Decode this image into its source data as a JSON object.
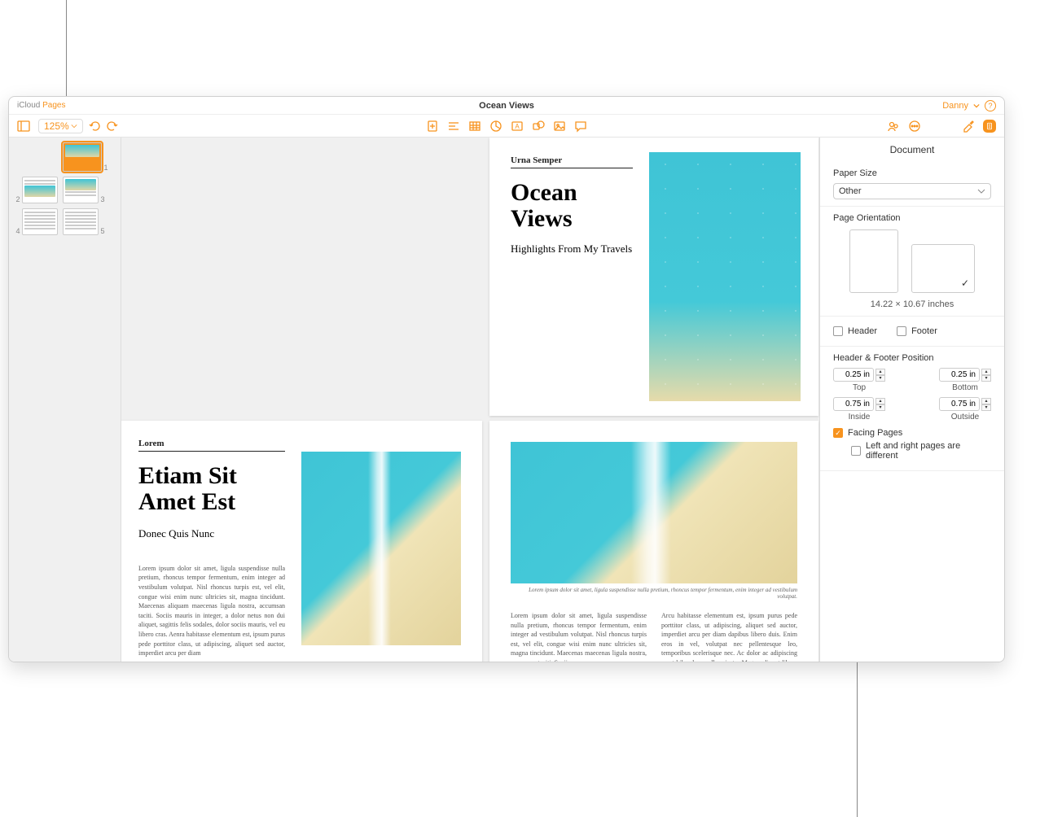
{
  "app": {
    "brand_prefix": "iCloud",
    "brand_name": "Pages"
  },
  "titlebar": {
    "doc_title": "Ocean Views",
    "user": "Danny"
  },
  "toolbar": {
    "zoom": "125%"
  },
  "thumbnails": {
    "pages": [
      1,
      2,
      3,
      4,
      5
    ],
    "selected": 1
  },
  "canvas": {
    "page1": {
      "header": "Urna Semper",
      "title": "Ocean Views",
      "subtitle": "Highlights From My Travels"
    },
    "page2": {
      "header": "Lorem",
      "title": "Etiam Sit Amet Est",
      "subtitle": "Donec Quis Nunc",
      "body": "Lorem ipsum dolor sit amet, ligula suspendisse nulla pretium, rhoncus tempor fermentum, enim integer ad vestibulum volutpat. Nisl rhoncus turpis est, vel elit, congue wisi enim nunc ultricies sit, magna tincidunt. Maecenas aliquam maecenas ligula nostra, accumsan taciti. Sociis mauris in integer, a dolor netus non dui aliquet, sagittis felis sodales, dolor sociis mauris, vel eu libero cras. Aenra habitasse elementum est, ipsum purus pede porttitor class, ut adipiscing, aliquet sed auctor, imperdiet arcu per diam"
    },
    "page3": {
      "caption": "Lorem ipsum dolor sit amet, ligula suspendisse nulla pretium, rhoncus tempor fermentum, enim integer ad vestibulum volutpat.",
      "col1": "Lorem ipsum dolor sit amet, ligula suspendisse nulla pretium, rhoncus tempor fermentum, enim integer ad vestibulum volutpat. Nisl rhoncus turpis est, vel elit, congue wisi enim nunc ultricies sit, magna tincidunt. Maecenas maecenas ligula nostra, accumsan taciti. Sociis",
      "col2": "Arcu habitasse elementum est, ipsum purus pede porttitor class, ut adipiscing, aliquet sed auctor, imperdiet arcu per diam dapibus libero duis. Enim eros in vel, volutpat nec pellentesque leo, temporibus scelerisque nec. Ac dolor ac adipiscing amet bibendum nullam justo. Magna aliquet libero lacus sociosqu. Diam nam"
    }
  },
  "inspector": {
    "title": "Document",
    "paper_size_label": "Paper Size",
    "paper_size_value": "Other",
    "page_orientation_label": "Page Orientation",
    "page_dimensions": "14.22 × 10.67 inches",
    "header_label": "Header",
    "footer_label": "Footer",
    "header_checked": false,
    "footer_checked": false,
    "hf_position_label": "Header & Footer Position",
    "margins": {
      "top": {
        "value": "0.25 in",
        "label": "Top"
      },
      "bottom": {
        "value": "0.25 in",
        "label": "Bottom"
      },
      "inside": {
        "value": "0.75 in",
        "label": "Inside"
      },
      "outside": {
        "value": "0.75 in",
        "label": "Outside"
      }
    },
    "facing_pages_label": "Facing Pages",
    "facing_pages_checked": true,
    "left_right_diff_label": "Left and right pages are different",
    "left_right_diff_checked": false
  }
}
